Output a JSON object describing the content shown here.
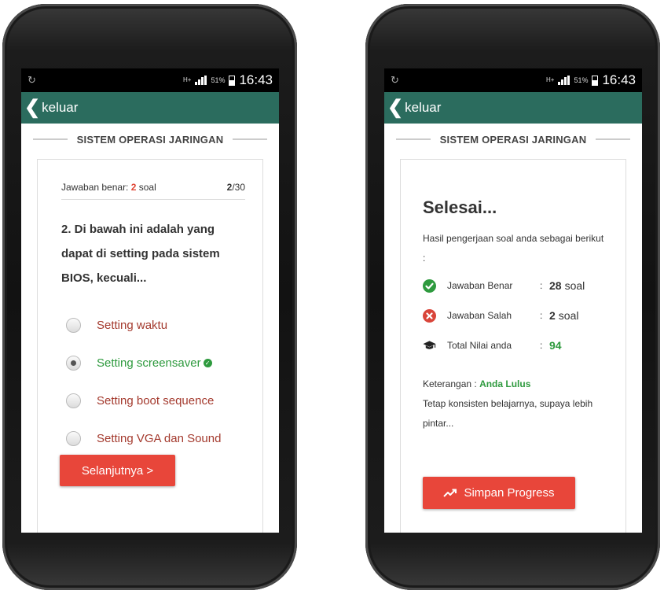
{
  "status": {
    "network": "H+",
    "battery": "51%",
    "time": "16:43"
  },
  "appbar": {
    "back_label": "keluar"
  },
  "section_title": "SISTEM OPERASI JARINGAN",
  "quiz": {
    "correct_prefix": "Jawaban benar: ",
    "correct_count": "2",
    "correct_suffix": " soal",
    "current": "2",
    "total": "/30",
    "question": "2. Di bawah ini adalah yang dapat di setting pada sistem BIOS, kecuali...",
    "options": [
      {
        "label": "Setting waktu"
      },
      {
        "label": "Setting screensaver"
      },
      {
        "label": "Setting boot sequence"
      },
      {
        "label": "Setting VGA dan Sound"
      }
    ],
    "selected_option_index": 1,
    "correct_option_index": 1,
    "next_button": "Selanjutnya >"
  },
  "result": {
    "title": "Selesai...",
    "description": "Hasil pengerjaan soal anda sebagai berikut :",
    "stats": [
      {
        "label": "Jawaban Benar",
        "colon": ":",
        "value": "28",
        "unit": "soal"
      },
      {
        "label": "Jawaban Salah",
        "colon": ":",
        "value": "2",
        "unit": "soal"
      },
      {
        "label": "Total Nilai anda",
        "colon": ":",
        "value": "94",
        "unit": ""
      }
    ],
    "keterangan_label": "Keterangan : ",
    "keterangan_value": "Anda Lulus",
    "message": "Tetap konsisten belajarnya, supaya lebih pintar...",
    "save_button": "Simpan Progress"
  },
  "colors": {
    "appbar": "#2b6c5e",
    "button": "#e8463a",
    "correct_green": "#2e9a3e",
    "option_red": "#a43a2e"
  }
}
